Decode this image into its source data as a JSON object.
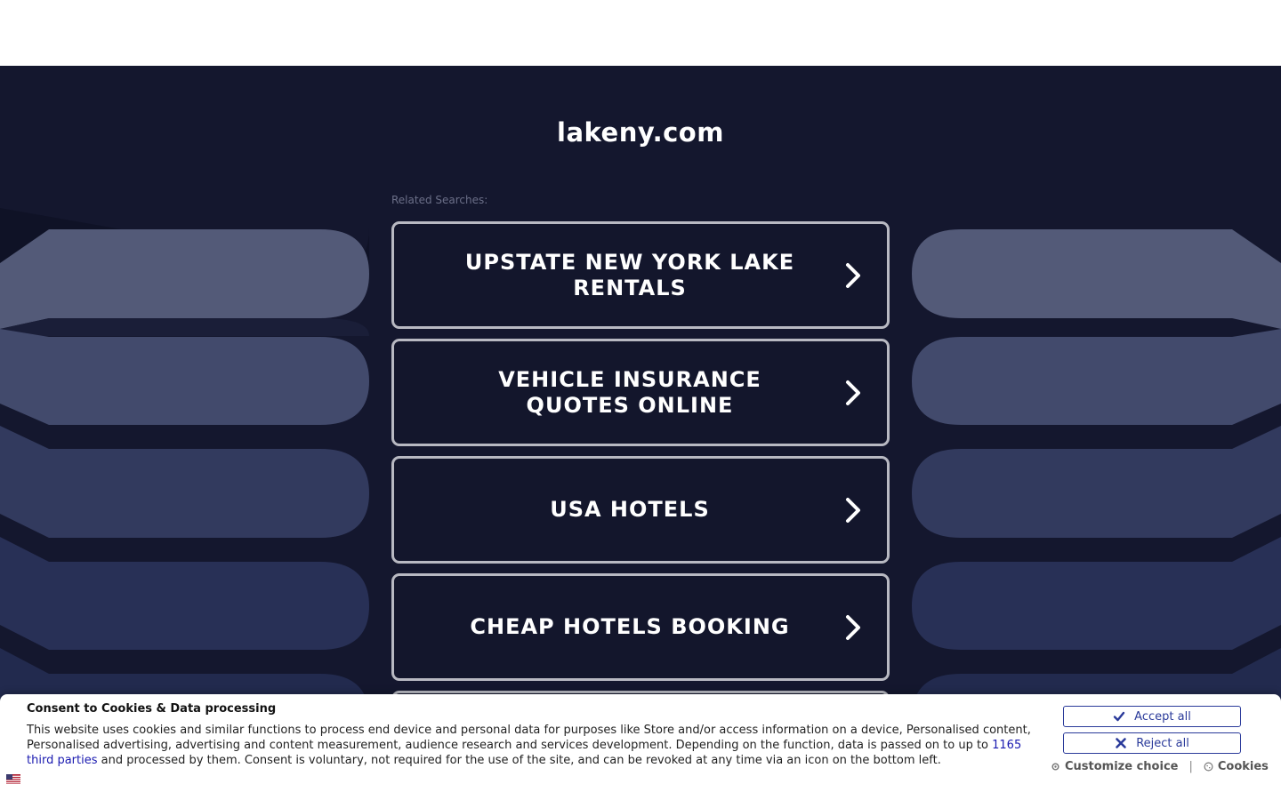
{
  "site": {
    "domain": "lakeny.com",
    "related_label": "Related Searches:"
  },
  "searches": [
    {
      "label": "UPSTATE NEW YORK LAKE RENTALS"
    },
    {
      "label": "VEHICLE INSURANCE QUOTES ONLINE"
    },
    {
      "label": "USA HOTELS"
    },
    {
      "label": "CHEAP HOTELS BOOKING"
    }
  ],
  "consent": {
    "title": "Consent to Cookies & Data processing",
    "text_before": "This website uses cookies and similar functions to process end device and personal data for purposes like Store and/or access information on a device, Personalised content, Personalised advertising, advertising and content measurement, audience research and services development. Depending on the function, data is passed on to up to ",
    "link_text": "1165 third parties",
    "text_after": " and processed by them. Consent is voluntary, not required for the use of the site, and can be revoked at any time via an icon on the bottom left.",
    "accept_label": "Accept all",
    "reject_label": "Reject all",
    "customize_label": "Customize choice",
    "cookies_label": "Cookies",
    "separator": "|"
  },
  "icons": {
    "chevron": "chevron-right-icon",
    "check": "check-icon",
    "cross": "x-icon",
    "gear": "gear-icon",
    "cookie": "cookie-icon",
    "flag": "flag-icon"
  },
  "colors": {
    "background": "#14172e",
    "button_border": "#b8b9c2",
    "consent_accent": "#2a3a9a",
    "link": "#1a1ab0"
  }
}
